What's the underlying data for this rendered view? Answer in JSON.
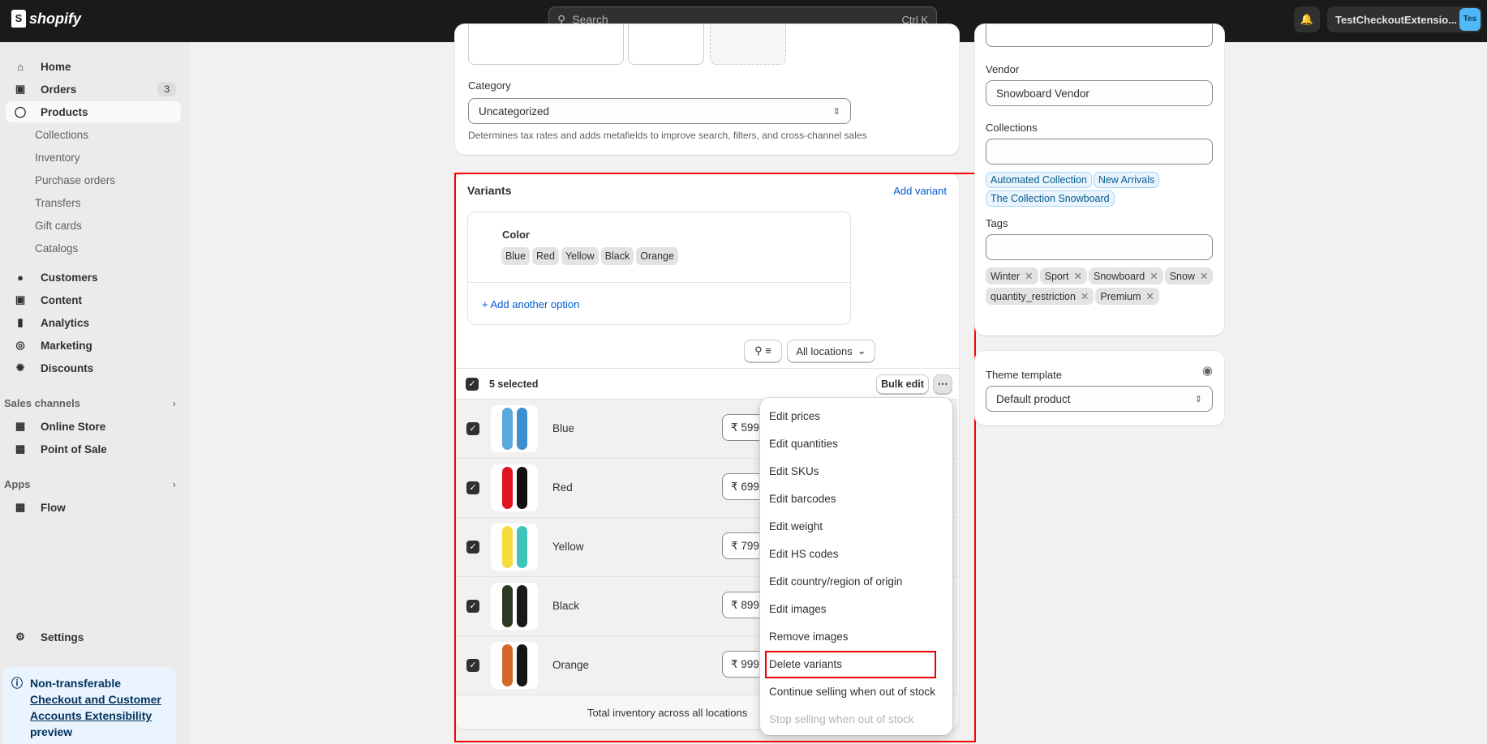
{
  "topbar": {
    "logo": "shopify",
    "search_placeholder": "Search",
    "search_shortcut": "Ctrl K",
    "store_name": "TestCheckoutExtensio...",
    "avatar": "Tes"
  },
  "sidebar": {
    "items": [
      {
        "label": "Home",
        "icon": "home-icon"
      },
      {
        "label": "Orders",
        "icon": "inbox-icon",
        "badge": "3"
      },
      {
        "label": "Products",
        "icon": "tag-icon"
      }
    ],
    "product_sub": [
      "Collections",
      "Inventory",
      "Purchase orders",
      "Transfers",
      "Gift cards",
      "Catalogs"
    ],
    "items2": [
      {
        "label": "Customers"
      },
      {
        "label": "Content"
      },
      {
        "label": "Analytics"
      },
      {
        "label": "Marketing"
      },
      {
        "label": "Discounts"
      }
    ],
    "sales_channels_label": "Sales channels",
    "channels": [
      "Online Store",
      "Point of Sale"
    ],
    "apps_label": "Apps",
    "apps": [
      "Flow"
    ],
    "settings": "Settings",
    "notice": {
      "prefix": "Non-transferable",
      "link": "Checkout and Customer Accounts Extensibility",
      "suffix": "preview"
    }
  },
  "category": {
    "label": "Category",
    "value": "Uncategorized",
    "help": "Determines tax rates and adds metafields to improve search, filters, and cross-channel sales"
  },
  "variants": {
    "title": "Variants",
    "add_variant": "Add variant",
    "option_name": "Color",
    "option_values": [
      "Blue",
      "Red",
      "Yellow",
      "Black",
      "Orange"
    ],
    "add_option": "+ Add another option",
    "locations": "All locations",
    "selected": "5 selected",
    "bulk_edit": "Bulk edit",
    "rows": [
      {
        "name": "Blue",
        "price": "₹ 599",
        "colors": [
          "#5aa9dc",
          "#3d8fd0"
        ]
      },
      {
        "name": "Red",
        "price": "₹ 699",
        "colors": [
          "#e0141e",
          "#111111"
        ]
      },
      {
        "name": "Yellow",
        "price": "₹ 799",
        "colors": [
          "#f5dc3c",
          "#3ec4b8"
        ]
      },
      {
        "name": "Black",
        "price": "₹ 899",
        "colors": [
          "#2b3a22",
          "#1a1a1a"
        ]
      },
      {
        "name": "Orange",
        "price": "₹ 999",
        "colors": [
          "#d2692a",
          "#151515"
        ]
      }
    ],
    "footer": "Total inventory across all locations"
  },
  "bulk_menu": [
    "Edit prices",
    "Edit quantities",
    "Edit SKUs",
    "Edit barcodes",
    "Edit weight",
    "Edit HS codes",
    "Edit country/region of origin",
    "Edit images",
    "Remove images",
    "Delete variants",
    "Continue selling when out of stock",
    "Stop selling when out of stock"
  ],
  "organization": {
    "vendor_label": "Vendor",
    "vendor": "Snowboard Vendor",
    "collections_label": "Collections",
    "collections": [
      "Automated Collection",
      "New Arrivals",
      "The Collection Snowboard"
    ],
    "tags_label": "Tags",
    "tags": [
      "Winter",
      "Sport",
      "Snowboard",
      "Snow",
      "quantity_restriction",
      "Premium"
    ]
  },
  "theme": {
    "label": "Theme template",
    "value": "Default product"
  }
}
